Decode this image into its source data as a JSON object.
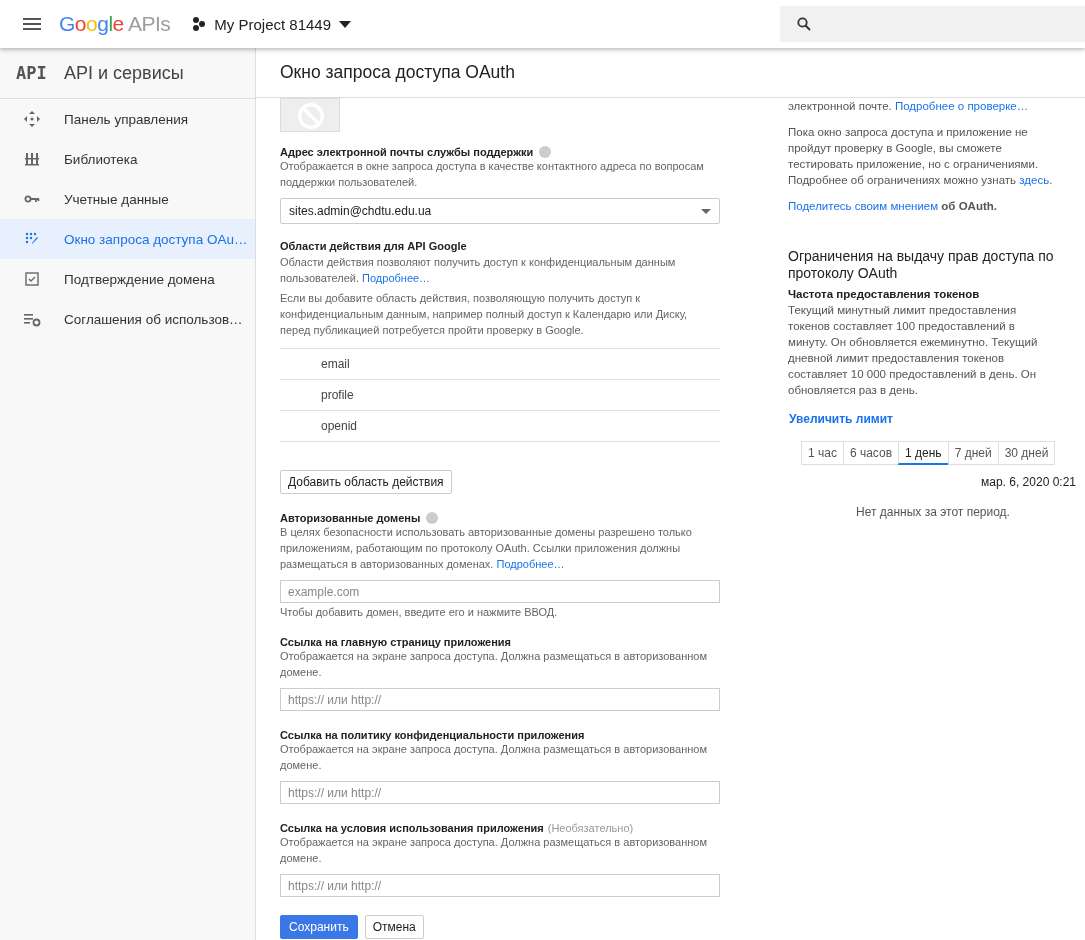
{
  "header": {
    "logo_brand": "Google",
    "logo_product": "APIs",
    "project": "My Project 81449"
  },
  "sidebar": {
    "mark": "API",
    "title": "API и сервисы",
    "items": [
      {
        "label": "Панель управления",
        "kind": "dashboard",
        "selected": false
      },
      {
        "label": "Библиотека",
        "kind": "library",
        "selected": false
      },
      {
        "label": "Учетные данные",
        "kind": "key",
        "selected": false
      },
      {
        "label": "Окно запроса доступа OAu…",
        "kind": "consent",
        "selected": true
      },
      {
        "label": "Подтверждение домена",
        "kind": "check",
        "selected": false
      },
      {
        "label": "Соглашения об использов…",
        "kind": "settings",
        "selected": false
      }
    ]
  },
  "page_title": "Окно запроса доступа OAuth",
  "support_email": {
    "label": "Адрес электронной почты службы поддержки",
    "description": "Отображается в окне запроса доступа в качестве контактного адреса по вопросам поддержки пользователей.",
    "value": "sites.admin@chdtu.edu.ua"
  },
  "scopes": {
    "label": "Области действия для API Google",
    "description": "Области действия позволяют получить доступ к конфиденциальным данным пользователей.",
    "link": "Подробнее…",
    "note": "Если вы добавите область действия, позволяющую получить доступ к конфиденциальным данным, например полный доступ к Календарю или Диску, перед публикацией потребуется пройти проверку в Google.",
    "items": [
      "email",
      "profile",
      "openid"
    ],
    "add_button": "Добавить область действия"
  },
  "authorized_domains": {
    "label": "Авторизованные домены",
    "description": "В целях безопасности использовать авторизованные домены разрешено только приложениям, работающим по протоколу OAuth. Ссылки приложения должны размещаться в авторизованных доменах.",
    "link": "Подробнее…",
    "placeholder": "example.com",
    "hint": "Чтобы добавить домен, введите его и нажмите ВВОД."
  },
  "link_fields": [
    {
      "label": "Ссылка на главную страницу приложения",
      "description": "Отображается на экране запроса доступа. Должна размещаться в авторизованном домене.",
      "placeholder": "https:// или http://"
    },
    {
      "label": "Ссылка на политику конфиденциальности приложения",
      "description": "Отображается на экране запроса доступа. Должна размещаться в авторизованном домене.",
      "placeholder": "https:// или http://"
    },
    {
      "label": "Ссылка на условия использования приложения",
      "optional": "(Необязательно)",
      "description": "Отображается на экране запроса доступа. Должна размещаться в авторизованном домене.",
      "placeholder": "https:// или http://"
    }
  ],
  "buttons": {
    "save": "Сохранить",
    "cancel": "Отмена"
  },
  "side_panel": {
    "top_text": "электронной почте.",
    "top_link": "Подробнее о проверке…",
    "verify_text": "Пока окно запроса доступа и приложение не пройдут проверку в Google, вы сможете тестировать приложение, но с ограничениями. Подробнее об ограничениях можно узнать",
    "verify_link": "здесь",
    "verify_end": ".",
    "feedback_link": "Поделитесь своим мнением",
    "feedback_text": "об OAuth.",
    "limits_title": "Ограничения на выдачу прав доступа по протоколу OAuth",
    "rate_title": "Частота предоставления токенов",
    "rate_text": "Текущий минутный лимит предоставления токенов составляет 100 предоставлений в минуту. Он обновляется ежеминутно. Текущий дневной лимит предоставления токенов составляет 10 000 предоставлений в день. Он обновляется раз в день.",
    "increase_link": "Увеличить лимит",
    "ranges": [
      {
        "label": "1 час",
        "selected": false
      },
      {
        "label": "6 часов",
        "selected": false
      },
      {
        "label": "1 день",
        "selected": true
      },
      {
        "label": "7 дней",
        "selected": false
      },
      {
        "label": "30 дней",
        "selected": false
      }
    ],
    "timestamp": "мар. 6, 2020 0:21",
    "empty": "Нет данных за этот период."
  }
}
